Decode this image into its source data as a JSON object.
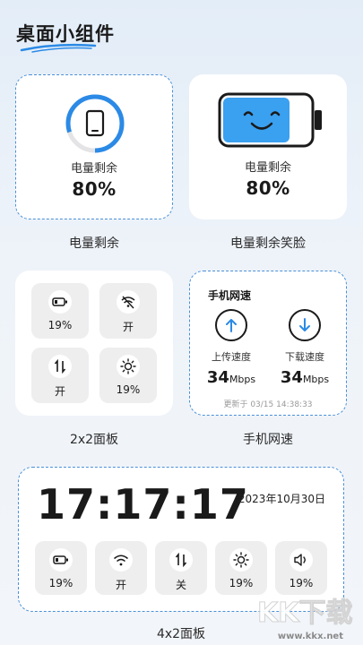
{
  "header": {
    "title": "桌面小组件"
  },
  "battery_widget": {
    "label": "电量剩余",
    "value": "80%",
    "caption": "电量剩余",
    "level": 0.8
  },
  "battery_face_widget": {
    "label": "电量剩余",
    "value": "80%",
    "caption": "电量剩余笑脸",
    "level": 0.8
  },
  "panel_2x2": {
    "caption": "2x2面板",
    "tiles": [
      {
        "icon": "battery-icon",
        "value": "19%"
      },
      {
        "icon": "wifi-off-icon",
        "value": "开"
      },
      {
        "icon": "data-transfer-icon",
        "value": "开"
      },
      {
        "icon": "brightness-icon",
        "value": "19%"
      }
    ]
  },
  "speed_widget": {
    "title": "手机网速",
    "upload_label": "上传速度",
    "download_label": "下载速度",
    "upload_value": "34",
    "download_value": "34",
    "unit": "Mbps",
    "updated": "更新于 03/15 14:38:33",
    "caption": "手机网速"
  },
  "panel_4x2": {
    "time": "17:17:17",
    "date": "2023年10月30日",
    "caption": "4x2面板",
    "tiles": [
      {
        "icon": "battery-icon",
        "value": "19%"
      },
      {
        "icon": "wifi-icon",
        "value": "开"
      },
      {
        "icon": "data-transfer-icon",
        "value": "关"
      },
      {
        "icon": "brightness-icon",
        "value": "19%"
      },
      {
        "icon": "volume-icon",
        "value": "19%"
      }
    ]
  },
  "watermark": {
    "text": "KK下载",
    "url": "www.kkx.net"
  },
  "colors": {
    "accent": "#2b8ae6",
    "dashed_border": "#4a90d9",
    "battery_fill": "#3aa0f0"
  }
}
